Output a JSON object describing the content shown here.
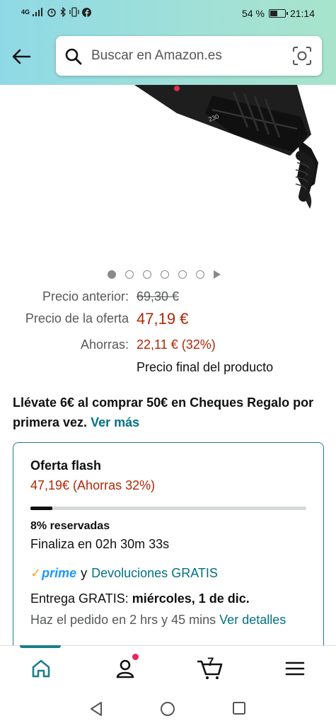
{
  "status_bar": {
    "network": "4G",
    "battery_percent": "54 %",
    "battery_level": 0.54,
    "time": "21:14"
  },
  "header": {
    "back_icon": "arrow-left-icon",
    "search_placeholder": "Buscar en Amazon.es",
    "camera_icon": "camera-scan-icon"
  },
  "gallery": {
    "image_text": "230",
    "dot_count": 6,
    "active_index": 0
  },
  "prices": {
    "previous_label": "Precio anterior:",
    "previous_value": "69,30 €",
    "offer_label": "Precio de la oferta",
    "offer_value": "47,19 €",
    "savings_label": "Ahorras:",
    "savings_value": "22,11 € (32%)",
    "final_note": "Precio final del producto"
  },
  "promo": {
    "text": "Llévate 6€ al comprar 50€ en Cheques Regalo por primera vez.",
    "link": "Ver más"
  },
  "flash_deal": {
    "title": "Oferta flash",
    "offer": "47,19€ (Ahorras 32%)",
    "claimed_fraction": 0.08,
    "reserved": "8% reservadas",
    "ends": "Finaliza en 02h 30m 33s",
    "prime_label": "prime",
    "prime_join": "y",
    "returns": "Devoluciones GRATIS",
    "delivery_prefix": "Entrega GRATIS:",
    "delivery_date": "miércoles, 1 de dic.",
    "order_text": "Haz el pedido en 2 hrs y 45 mins",
    "details_link": "Ver detalles"
  },
  "bottom_nav": {
    "items": [
      "home-icon",
      "account-icon",
      "cart-icon",
      "menu-icon"
    ],
    "cart_count": "7"
  },
  "colors": {
    "accent": "#007185",
    "price_red": "#b12704",
    "header_gradient_start": "#8fd9e6",
    "header_gradient_end": "#a8e4cc"
  }
}
